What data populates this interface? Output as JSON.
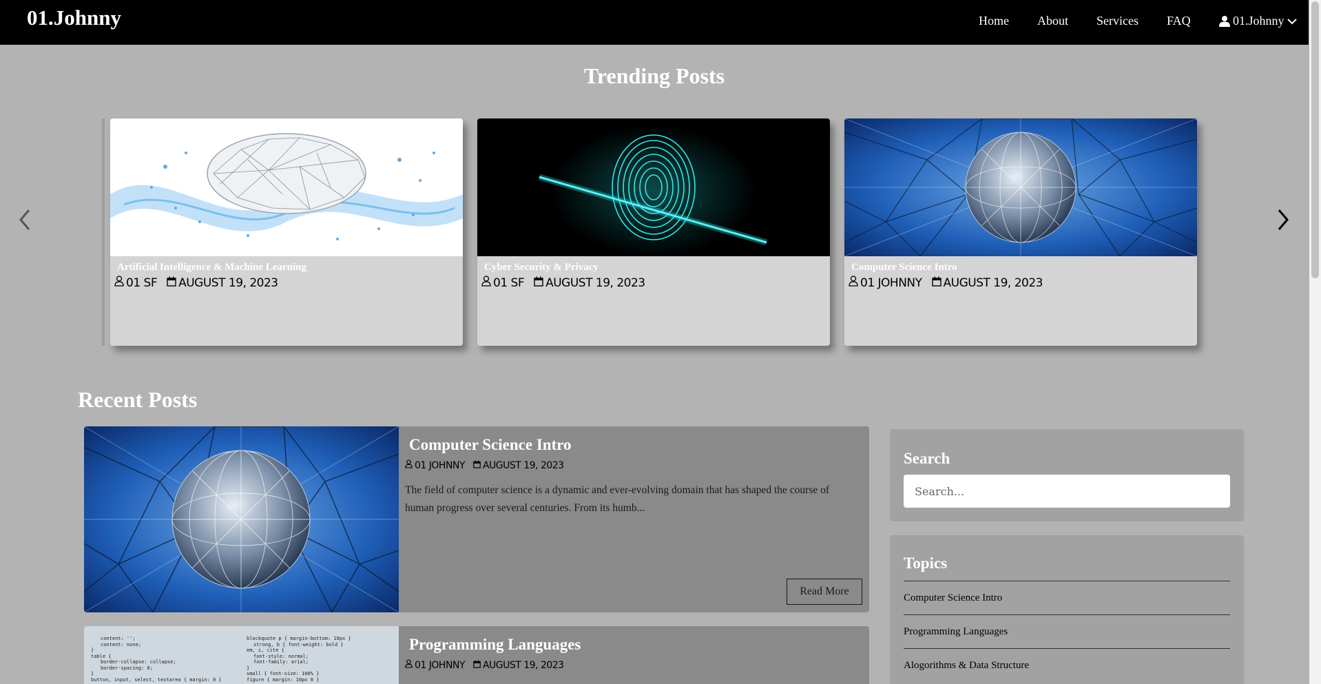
{
  "nav": {
    "brand": "01.Johnny",
    "links": [
      "Home",
      "About",
      "Services",
      "FAQ"
    ],
    "user": "01.Johnny",
    "icons": {
      "user": "user-icon",
      "dropdown": "chevron-down-icon"
    }
  },
  "trending": {
    "title": "Trending Posts",
    "cards": [
      {
        "category": "Artificial Intelligence & Machine Learning",
        "author": "01 SF",
        "date": "AUGUST 19, 2023",
        "image": "ai-brain-network-image"
      },
      {
        "category": "Cyber Security & Privacy",
        "author": "01 SF",
        "date": "AUGUST 19, 2023",
        "image": "glowing-fingerprint-image"
      },
      {
        "category": "Computer Science Intro",
        "author": "01 JOHNNY",
        "date": "AUGUST 19, 2023",
        "image": "network-globe-image"
      }
    ]
  },
  "recent": {
    "title": "Recent Posts",
    "posts": [
      {
        "title": "Computer Science Intro",
        "author": "01 JOHNNY",
        "date": "AUGUST 19, 2023",
        "excerpt": "The field of computer science is a dynamic and ever-evolving domain that has shaped the course of human progress over several centuries. From its humb...",
        "read_more": "Read More"
      },
      {
        "title": "Programming Languages",
        "author": "01 JOHNNY",
        "date": "AUGUST 19, 2023"
      }
    ]
  },
  "sidebar": {
    "search": {
      "title": "Search",
      "placeholder": "Search..."
    },
    "topics": {
      "title": "Topics",
      "items": [
        "Computer Science Intro",
        "Programming Languages",
        "Alogorithms & Data Structure"
      ]
    }
  },
  "code_snippet": {
    "left": [
      "content: '';",
      "content: none;",
      "}",
      "table {",
      "border-collapse: collapse;",
      "border-spacing: 0;",
      "}",
      "button, input, select, textarea { margin: 0 }"
    ],
    "right": [
      "blockquote p { margin-bottom: 10px }",
      "strong, b { font-weight: bold }",
      "em, i, cite {",
      "font-style: normal;",
      "font-family: arial;",
      "}",
      "small { font-size: 100% }",
      "figure { margin: 10px 0 }"
    ]
  }
}
